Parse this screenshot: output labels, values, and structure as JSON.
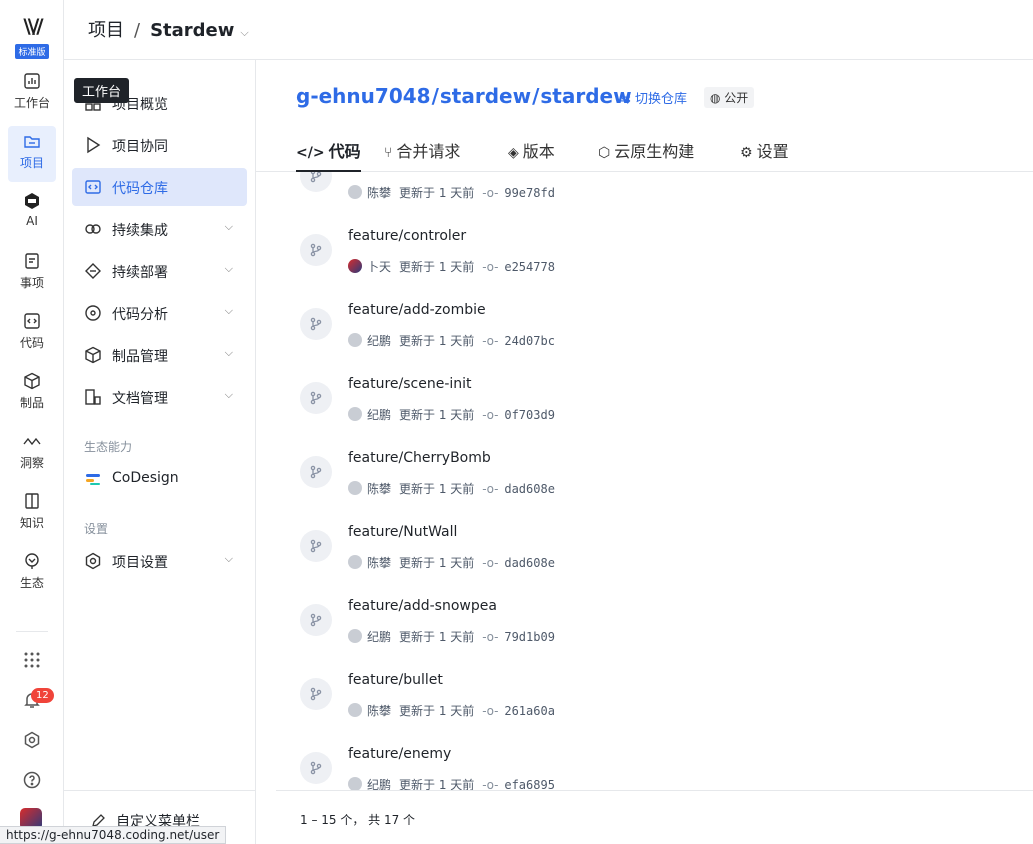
{
  "rail": {
    "logo_badge": "标准版",
    "items": [
      {
        "label": "工作台",
        "icon": "dashboard-icon"
      },
      {
        "label": "项目",
        "icon": "folder-icon",
        "active": true
      },
      {
        "label": "AI",
        "icon": "ai-icon"
      },
      {
        "label": "事项",
        "icon": "task-icon"
      },
      {
        "label": "代码",
        "icon": "code-icon"
      },
      {
        "label": "制品",
        "icon": "package-icon"
      },
      {
        "label": "洞察",
        "icon": "insight-icon"
      },
      {
        "label": "知识",
        "icon": "book-icon"
      },
      {
        "label": "生态",
        "icon": "ecosystem-icon"
      }
    ],
    "notification_count": "12"
  },
  "header": {
    "crumb_root": "项目",
    "crumb_sep": "/",
    "crumb_project": "Stardew"
  },
  "tooltip": "工作台",
  "sidenav": {
    "items": [
      {
        "label": "项目概览",
        "icon": "grid-icon"
      },
      {
        "label": "项目协同",
        "icon": "play-icon"
      },
      {
        "label": "代码仓库",
        "icon": "code-repo-icon",
        "active": true
      },
      {
        "label": "持续集成",
        "icon": "ci-icon",
        "expand": true
      },
      {
        "label": "持续部署",
        "icon": "cd-icon",
        "expand": true
      },
      {
        "label": "代码分析",
        "icon": "analysis-icon",
        "expand": true
      },
      {
        "label": "制品管理",
        "icon": "box-icon",
        "expand": true
      },
      {
        "label": "文档管理",
        "icon": "doc-icon",
        "expand": true
      }
    ],
    "section_ecosystem": "生态能力",
    "codesign": "CoDesign",
    "section_settings": "设置",
    "project_settings": "项目设置",
    "custom_menu": "自定义菜单栏"
  },
  "repo": {
    "team": "g-ehnu7048",
    "project": "stardew",
    "name": "stardew",
    "switch_label": "切换仓库",
    "visibility": "公开"
  },
  "tabs": [
    {
      "label": "代码",
      "icon": "</>",
      "active": true
    },
    {
      "label": "合并请求",
      "icon": "⑂"
    },
    {
      "label": "版本",
      "icon": "◈"
    },
    {
      "label": "云原生构建",
      "icon": "⬡"
    },
    {
      "label": "设置",
      "icon": "⚙"
    }
  ],
  "branches": [
    {
      "name": "",
      "author": "陈攀",
      "updated": "更新于 1 天前",
      "hash": "99e78fd",
      "avatar": "gray"
    },
    {
      "name": "feature/controler",
      "author": "卜天",
      "updated": "更新于 1 天前",
      "hash": "e254778",
      "avatar": "red"
    },
    {
      "name": "feature/add-zombie",
      "author": "纪鹏",
      "updated": "更新于 1 天前",
      "hash": "24d07bc",
      "avatar": "gray"
    },
    {
      "name": "feature/scene-init",
      "author": "纪鹏",
      "updated": "更新于 1 天前",
      "hash": "0f703d9",
      "avatar": "gray"
    },
    {
      "name": "feature/CherryBomb",
      "author": "陈攀",
      "updated": "更新于 1 天前",
      "hash": "dad608e",
      "avatar": "gray"
    },
    {
      "name": "feature/NutWall",
      "author": "陈攀",
      "updated": "更新于 1 天前",
      "hash": "dad608e",
      "avatar": "gray"
    },
    {
      "name": "feature/add-snowpea",
      "author": "纪鹏",
      "updated": "更新于 1 天前",
      "hash": "79d1b09",
      "avatar": "gray"
    },
    {
      "name": "feature/bullet",
      "author": "陈攀",
      "updated": "更新于 1 天前",
      "hash": "261a60a",
      "avatar": "gray"
    },
    {
      "name": "feature/enemy",
      "author": "纪鹏",
      "updated": "更新于 1 天前",
      "hash": "efa6895",
      "avatar": "gray"
    }
  ],
  "pagination": "1 – 15 个， 共 17 个",
  "status_url": "https://g-ehnu7048.coding.net/user"
}
